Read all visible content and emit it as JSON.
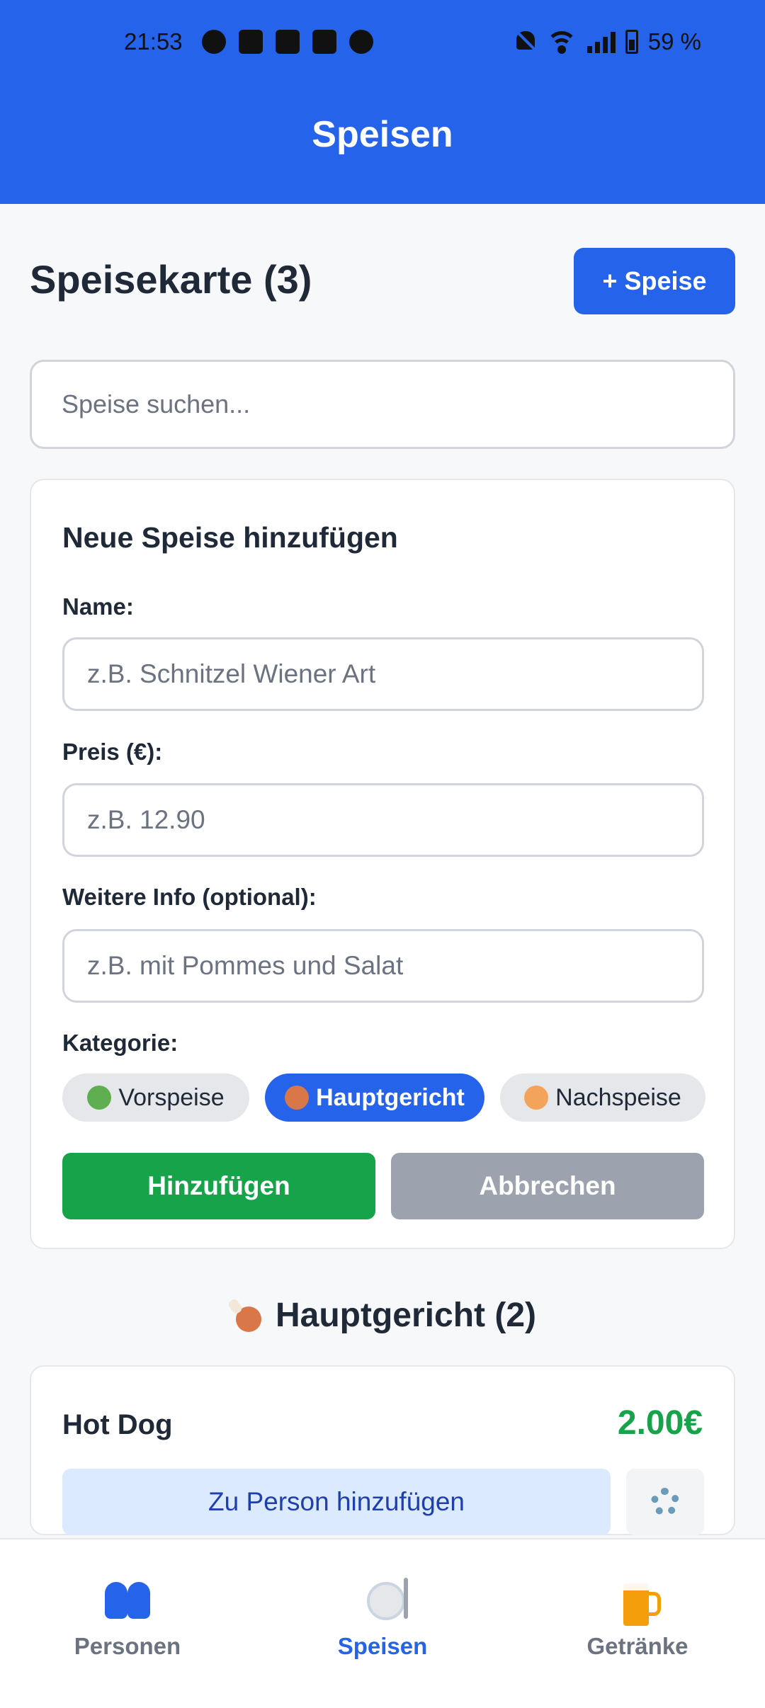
{
  "status_bar": {
    "time": "21:53",
    "battery": "59 %"
  },
  "header": {
    "title": "Speisen"
  },
  "menu": {
    "title": "Speisekarte (3)",
    "add_button": "+ Speise"
  },
  "search": {
    "placeholder": "Speise suchen..."
  },
  "form": {
    "title": "Neue Speise hinzufügen",
    "name_label": "Name:",
    "name_placeholder": "z.B. Schnitzel Wiener Art",
    "price_label": "Preis (€):",
    "price_placeholder": "z.B. 12.90",
    "info_label": "Weitere Info (optional):",
    "info_placeholder": "z.B. mit Pommes und Salat",
    "category_label": "Kategorie:",
    "categories": [
      {
        "label": "Vorspeise",
        "icon": "salad-icon",
        "selected": false
      },
      {
        "label": "Hauptgericht",
        "icon": "meat-icon",
        "selected": true
      },
      {
        "label": "Nachspeise",
        "icon": "cake-icon",
        "selected": false
      }
    ],
    "submit_label": "Hinzufügen",
    "cancel_label": "Abbrechen"
  },
  "category_group": {
    "title": "Hauptgericht (2)",
    "icon": "meat-icon"
  },
  "items": [
    {
      "name": "Hot Dog",
      "price": "2.00€",
      "add_label": "Zu Person hinzufügen"
    }
  ],
  "nav": {
    "items": [
      {
        "label": "Personen",
        "icon": "people-icon",
        "active": false
      },
      {
        "label": "Speisen",
        "icon": "plate-icon",
        "active": true
      },
      {
        "label": "Getränke",
        "icon": "beer-icon",
        "active": false
      }
    ]
  },
  "colors": {
    "primary": "#2563eb",
    "success": "#16a34a",
    "muted": "#9ca3af"
  }
}
